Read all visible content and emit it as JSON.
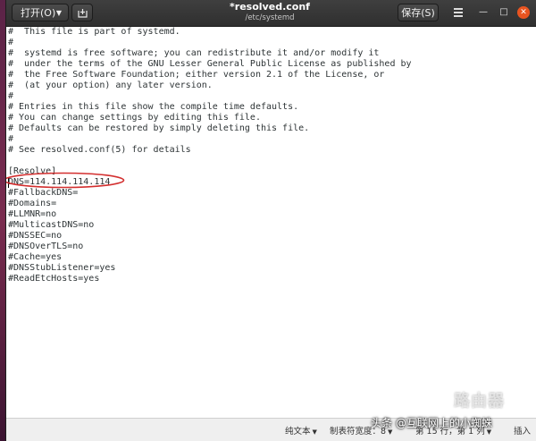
{
  "headerbar": {
    "open_label": "打开(O)",
    "title": "*resolved.conf",
    "subtitle": "/etc/systemd",
    "save_label": "保存(S)"
  },
  "editor": {
    "lines": [
      "#  This file is part of systemd.",
      "#",
      "#  systemd is free software; you can redistribute it and/or modify it",
      "#  under the terms of the GNU Lesser General Public License as published by",
      "#  the Free Software Foundation; either version 2.1 of the License, or",
      "#  (at your option) any later version.",
      "#",
      "# Entries in this file show the compile time defaults.",
      "# You can change settings by editing this file.",
      "# Defaults can be restored by simply deleting this file.",
      "#",
      "# See resolved.conf(5) for details",
      "",
      "[Resolve]",
      "DNS=114.114.114.114",
      "#FallbackDNS=",
      "#Domains=",
      "#LLMNR=no",
      "#MulticastDNS=no",
      "#DNSSEC=no",
      "#DNSOverTLS=no",
      "#Cache=yes",
      "#DNSStubListener=yes",
      "#ReadEtcHosts=yes"
    ]
  },
  "statusbar": {
    "syntax": "纯文本",
    "tab_width": "制表符宽度：8",
    "position": "第 15 行，第 1 列",
    "mode": "插入"
  },
  "watermark": {
    "brand": "路由器",
    "signature": "头条 @互联网上的小蜘蛛"
  },
  "colors": {
    "accent": "#e95420",
    "annotation": "#d32f2f"
  }
}
